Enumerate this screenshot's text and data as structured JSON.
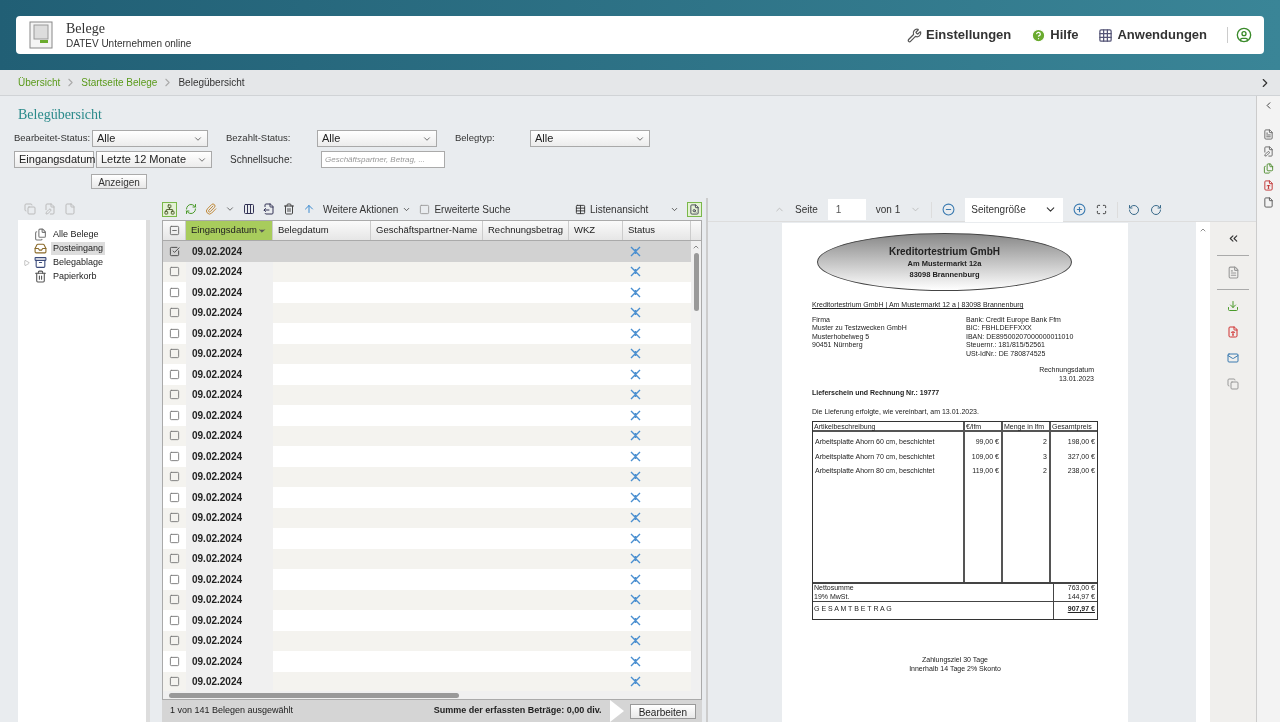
{
  "header": {
    "title": "Belege",
    "subtitle": "DATEV Unternehmen online",
    "actions": [
      {
        "kind": "settings",
        "label": "Einstellungen"
      },
      {
        "kind": "help",
        "label": "Hilfe"
      },
      {
        "kind": "apps",
        "label": "Anwendungen"
      },
      {
        "kind": "user"
      }
    ]
  },
  "breadcrumb": [
    {
      "label": "Übersicht",
      "current": false
    },
    {
      "label": "Startseite Belege",
      "current": false
    },
    {
      "label": "Belegübersicht",
      "current": true
    }
  ],
  "page_title": "Belegübersicht",
  "filters": [
    {
      "label": "Bearbeitet-Status:",
      "value": "Alle"
    },
    {
      "label": "Bezahlt-Status:",
      "value": "Alle"
    },
    {
      "label": "Belegtyp:",
      "value": "Alle"
    }
  ],
  "date_filter": {
    "field": "Eingangsdatum",
    "range": "Letzte 12 Monate"
  },
  "quick_search": {
    "label": "Schnellsuche:",
    "placeholder": "Geschäftspartner, Betrag, ..."
  },
  "show_button": "Anzeigen",
  "toolbar": {
    "more_actions": "Weitere Aktionen",
    "extended_search": {
      "label": "Erweiterte Suche",
      "checked": false
    },
    "view": "Listenansicht"
  },
  "tree": [
    {
      "kind": "all",
      "label": "Alle Belege",
      "selected": false,
      "expandable": false
    },
    {
      "kind": "inbox",
      "label": "Posteingang",
      "selected": true,
      "expandable": false
    },
    {
      "kind": "archive",
      "label": "Belegablage",
      "selected": false,
      "expandable": true
    },
    {
      "kind": "trash",
      "label": "Papierkorb",
      "selected": false,
      "expandable": false
    }
  ],
  "table": {
    "select_all": {
      "checked": false,
      "indeterminate": true
    },
    "columns": [
      {
        "label": "Eingangsdatum",
        "sorted": true
      },
      {
        "label": "Belegdatum",
        "sorted": false
      },
      {
        "label": "Geschäftspartner-Name",
        "sorted": false
      },
      {
        "label": "Rechnungsbetrag",
        "sorted": false
      },
      {
        "label": "WKZ",
        "sorted": false
      },
      {
        "label": "Status",
        "sorted": false
      }
    ],
    "rows": [
      {
        "date": "09.02.2024",
        "selected": true
      },
      {
        "date": "09.02.2024",
        "selected": false
      },
      {
        "date": "09.02.2024",
        "selected": false
      },
      {
        "date": "09.02.2024",
        "selected": false
      },
      {
        "date": "09.02.2024",
        "selected": false
      },
      {
        "date": "09.02.2024",
        "selected": false
      },
      {
        "date": "09.02.2024",
        "selected": false
      },
      {
        "date": "09.02.2024",
        "selected": false
      },
      {
        "date": "09.02.2024",
        "selected": false
      },
      {
        "date": "09.02.2024",
        "selected": false
      },
      {
        "date": "09.02.2024",
        "selected": false
      },
      {
        "date": "09.02.2024",
        "selected": false
      },
      {
        "date": "09.02.2024",
        "selected": false
      },
      {
        "date": "09.02.2024",
        "selected": false
      },
      {
        "date": "09.02.2024",
        "selected": false
      },
      {
        "date": "09.02.2024",
        "selected": false
      },
      {
        "date": "09.02.2024",
        "selected": false
      },
      {
        "date": "09.02.2024",
        "selected": false
      },
      {
        "date": "09.02.2024",
        "selected": false
      },
      {
        "date": "09.02.2024",
        "selected": false
      },
      {
        "date": "09.02.2024",
        "selected": false
      },
      {
        "date": "09.02.2024",
        "selected": false
      }
    ]
  },
  "status_bar": {
    "selection": "1 von 141 Belegen ausgewählt",
    "sum": "Summe der erfassten Beträge: 0,00 div.",
    "button": "Bearbeiten"
  },
  "viewer": {
    "page_label": "Seite",
    "page_value": "1",
    "page_of": "von 1",
    "zoom": "Seitengröße"
  },
  "document": {
    "company": "Kreditortestrium GmbH",
    "street": "Am Mustermarkt 12a",
    "city": "83098 Brannenburg",
    "sender_line": "Kreditortestrium GmbH | Am Mustermarkt 12 a | 83098 Brannenburg",
    "recipient": [
      "Firma",
      "Muster zu Testzwecken GmbH",
      "Musterhobelweg 5",
      "90451 Nürnberg"
    ],
    "bank": [
      "Bank: Credit Europe Bank Ffm",
      "BIC: FBHLDEFFXXX",
      "IBAN: DE89500207000000011010",
      "Steuernr.: 181/815/52561",
      "USt-IdNr.: DE 780874525"
    ],
    "date_label": "Rechnungsdatum",
    "date": "13.01.2023",
    "subject": "Lieferschein und Rechnung Nr.: 19777",
    "intro": "Die Lieferung erfolgte, wie vereinbart, am 13.01.2023.",
    "columns": [
      "Artikelbeschreibung",
      "€/lfm",
      "Menge in lfm",
      "Gesamtpreis"
    ],
    "items": [
      [
        "Arbeitsplatte Ahorn 60 cm, beschichtet",
        "99,00 €",
        "2",
        "198,00 €"
      ],
      [
        "Arbeitsplatte Ahorn 70 cm, beschichtet",
        "109,00 €",
        "3",
        "327,00 €"
      ],
      [
        "Arbeitsplatte Ahorn 80 cm, beschichtet",
        "119,00 €",
        "2",
        "238,00 €"
      ]
    ],
    "net_label": "Nettosumme",
    "net": "763,00 €",
    "vat_label": "19% MwSt.",
    "vat": "144,97 €",
    "total_label": "G E S A M T B E T R A G",
    "total": "907,97 €",
    "footer": [
      "Zahlungsziel 30 Tage",
      "Innerhalb 14 Tage 2% Skonto"
    ]
  }
}
